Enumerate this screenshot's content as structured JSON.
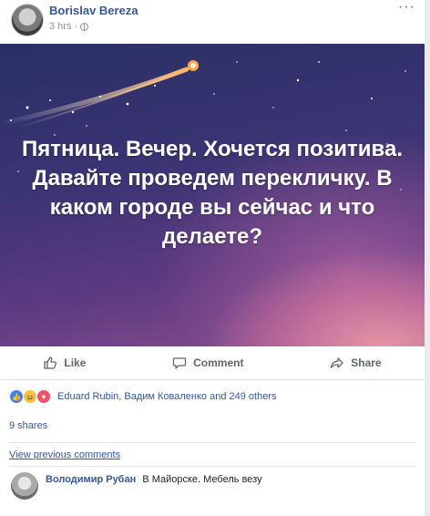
{
  "post": {
    "author": "Borislav Bereza",
    "time": "3 hrs · ",
    "more": "···",
    "image_text": "Пятница. Вечер. Хочется позитива. Давайте проведем перекличку. В каком городе вы сейчас и что делаете?"
  },
  "actions": {
    "like": "Like",
    "comment": "Comment",
    "share": "Share"
  },
  "reactions": {
    "summary": "Eduard Rubin, Вадим Коваленко and 249 others"
  },
  "shares": "9 shares",
  "view_previous": "View previous comments",
  "comment": {
    "author": "Володимир Рубан",
    "text": "В Майорске. Мебель везу"
  },
  "colors": {
    "link": "#365899",
    "muted": "#90949c",
    "like_blue": "#4080ff",
    "love_red": "#f25268",
    "haha_yellow": "#f7c548"
  }
}
